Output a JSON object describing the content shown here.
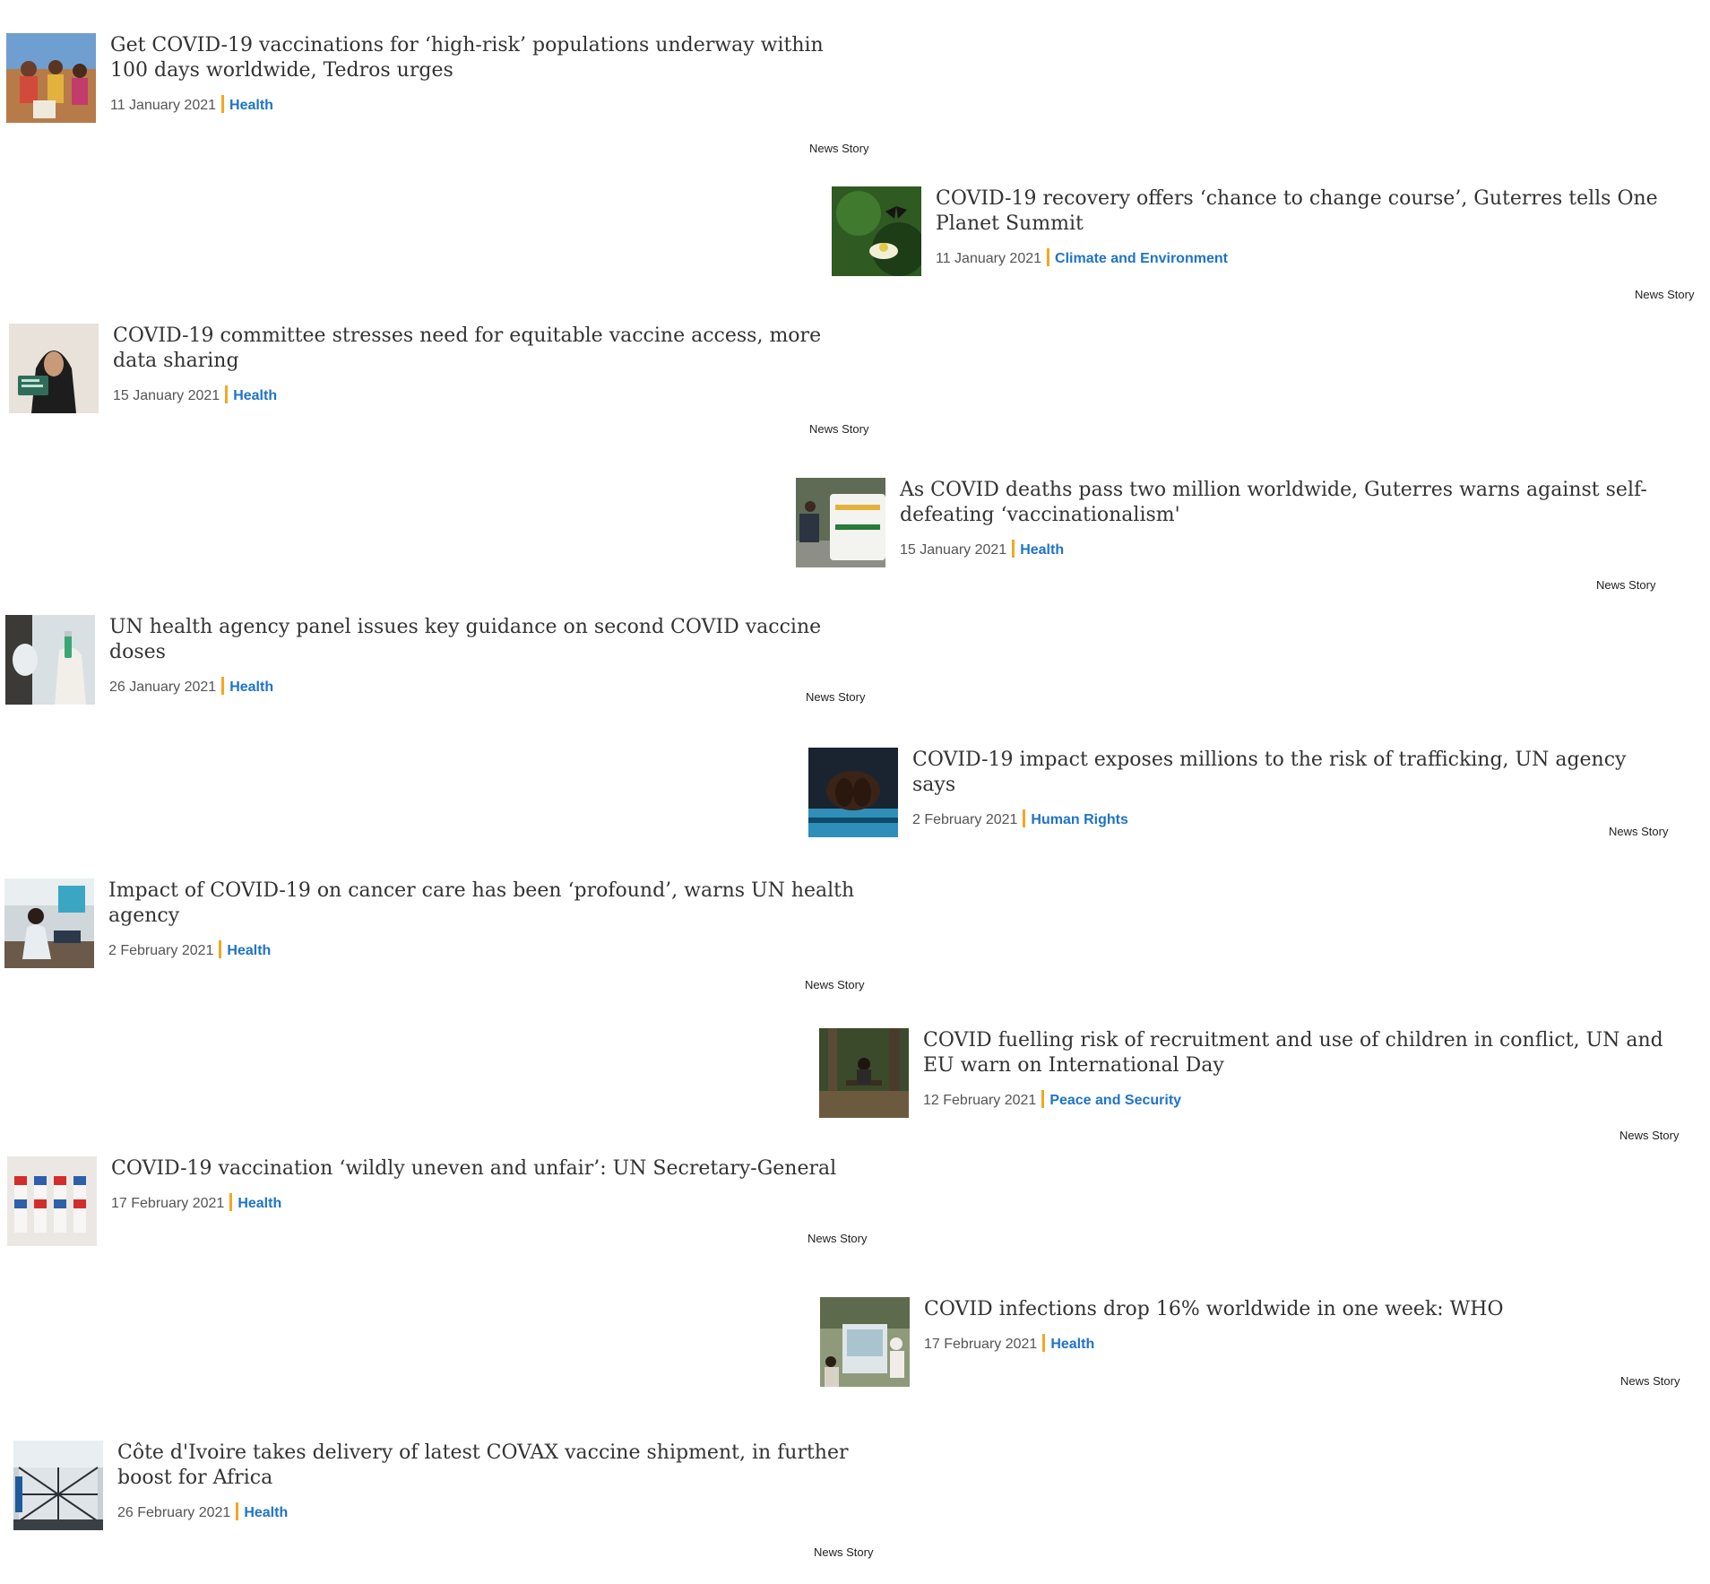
{
  "stories": [
    {
      "title": "Get COVID-19 vaccinations for ‘high-risk’ populations underway within 100 days worldwide, Tedros urges",
      "date": "11 January 2021",
      "category": "Health",
      "type": "News Story",
      "thumb_icon": "crowd-photo-icon",
      "color": "#c98a4b"
    },
    {
      "title": "COVID-19 recovery offers ‘chance to change course’, Guterres tells One Planet Summit",
      "date": "11 January 2021",
      "category": "Climate and Environment",
      "type": "News Story",
      "thumb_icon": "flower-photo-icon",
      "color": "#3e6b2a"
    },
    {
      "title": "COVID-19 committee stresses need for equitable vaccine access, more data sharing",
      "date": "15 January 2021",
      "category": "Health",
      "type": "News Story",
      "thumb_icon": "woman-card-photo-icon",
      "color": "#d8c9b6"
    },
    {
      "title": "As COVID deaths pass two million worldwide, Guterres warns against self-defeating ‘vaccinationalism'",
      "date": "15 January 2021",
      "category": "Health",
      "type": "News Story",
      "thumb_icon": "ambulance-photo-icon",
      "color": "#cfd6c9"
    },
    {
      "title": "UN health agency panel issues key guidance on second COVID vaccine doses",
      "date": "26 January 2021",
      "category": "Health",
      "type": "News Story",
      "thumb_icon": "vaccine-vial-photo-icon",
      "color": "#b9c7cf"
    },
    {
      "title": "COVID-19 impact exposes millions to the risk of trafficking, UN agency says",
      "date": "2 February 2021",
      "category": "Human Rights",
      "type": "News Story",
      "thumb_icon": "hands-photo-icon",
      "color": "#2c3a4a"
    },
    {
      "title": "Impact of COVID-19 on cancer care has been ‘profound’, warns UN health agency",
      "date": "2 February 2021",
      "category": "Health",
      "type": "News Story",
      "thumb_icon": "clinic-photo-icon",
      "color": "#7d8f99"
    },
    {
      "title": "COVID fuelling risk of recruitment and use of children in conflict, UN and EU warn on International Day",
      "date": "12 February 2021",
      "category": "Peace and Security",
      "type": "News Story",
      "thumb_icon": "forest-bench-photo-icon",
      "color": "#4f5e3b"
    },
    {
      "title": "COVID-19 vaccination ‘wildly uneven and unfair’: UN Secretary-General",
      "date": "17 February 2021",
      "category": "Health",
      "type": "News Story",
      "thumb_icon": "vials-photo-icon",
      "color": "#e3e1de"
    },
    {
      "title": "COVID infections drop 16% worldwide in one week: WHO",
      "date": "17 February 2021",
      "category": "Health",
      "type": "News Story",
      "thumb_icon": "testing-booth-photo-icon",
      "color": "#9aa68a"
    },
    {
      "title": "Côte d'Ivoire takes delivery of latest COVAX vaccine shipment, in further boost for Africa",
      "date": "26 February 2021",
      "category": "Health",
      "type": "News Story",
      "thumb_icon": "cargo-shipment-photo-icon",
      "color": "#aeb7bf"
    }
  ]
}
